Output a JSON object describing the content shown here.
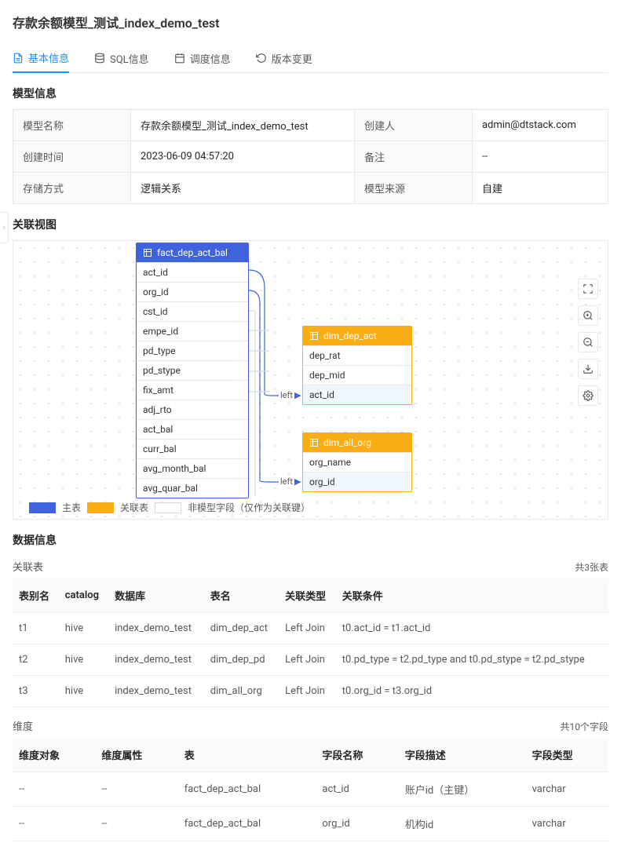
{
  "page_title": "存款余额模型_测试_index_demo_test",
  "tabs": [
    {
      "label": "基本信息"
    },
    {
      "label": "SQL信息"
    },
    {
      "label": "调度信息"
    },
    {
      "label": "版本变更"
    }
  ],
  "sections": {
    "model_info_title": "模型信息",
    "relation_view_title": "关联视图",
    "data_info_title": "数据信息"
  },
  "model_info": {
    "labels": {
      "model_name": "模型名称",
      "creator": "创建人",
      "create_time": "创建时间",
      "remark": "备注",
      "storage": "存储方式",
      "source": "模型来源"
    },
    "values": {
      "model_name": "存款余额模型_测试_index_demo_test",
      "creator": "admin@dtstack.com",
      "create_time": "2023-06-09 04:57:20",
      "remark": "--",
      "storage": "逻辑关系",
      "source": "自建"
    }
  },
  "diagram": {
    "main_table": {
      "name": "fact_dep_act_bal",
      "fields": [
        "act_id",
        "org_id",
        "cst_id",
        "empe_id",
        "pd_type",
        "pd_stype",
        "fix_amt",
        "adj_rto",
        "act_bal",
        "curr_bal",
        "avg_month_bal",
        "avg_quar_bal"
      ]
    },
    "rel_tables": [
      {
        "name": "dim_dep_act",
        "fields": [
          "dep_rat",
          "dep_mid",
          "act_id"
        ],
        "highlight_index": 2,
        "join_label": "left"
      },
      {
        "name": "dim_all_org",
        "fields": [
          "org_name",
          "org_id"
        ],
        "highlight_index": 1,
        "join_label": "left"
      }
    ],
    "legend": {
      "main": "主表",
      "rel": "关联表",
      "nonmodel": "非模型字段（仅作为关联键）"
    }
  },
  "related_tables": {
    "title": "关联表",
    "count_text": "共3张表",
    "headers": [
      "表别名",
      "catalog",
      "数据库",
      "表名",
      "关联类型",
      "关联条件"
    ],
    "rows": [
      {
        "alias": "t1",
        "catalog": "hive",
        "db": "index_demo_test",
        "table": "dim_dep_act",
        "join": "Left Join",
        "cond": "t0.act_id = t1.act_id"
      },
      {
        "alias": "t2",
        "catalog": "hive",
        "db": "index_demo_test",
        "table": "dim_dep_pd",
        "join": "Left Join",
        "cond": "t0.pd_type = t2.pd_type and t0.pd_stype = t2.pd_stype"
      },
      {
        "alias": "t3",
        "catalog": "hive",
        "db": "index_demo_test",
        "table": "dim_all_org",
        "join": "Left Join",
        "cond": "t0.org_id = t3.org_id"
      }
    ]
  },
  "dimensions": {
    "title": "维度",
    "count_text": "共10个字段",
    "headers": [
      "维度对象",
      "维度属性",
      "表",
      "字段名称",
      "字段描述",
      "字段类型"
    ],
    "rows": [
      {
        "obj": "--",
        "attr": "--",
        "table": "fact_dep_act_bal",
        "field": "act_id",
        "desc": "账户id（主键）",
        "type": "varchar"
      },
      {
        "obj": "--",
        "attr": "--",
        "table": "fact_dep_act_bal",
        "field": "org_id",
        "desc": "机构id",
        "type": "varchar"
      }
    ]
  }
}
